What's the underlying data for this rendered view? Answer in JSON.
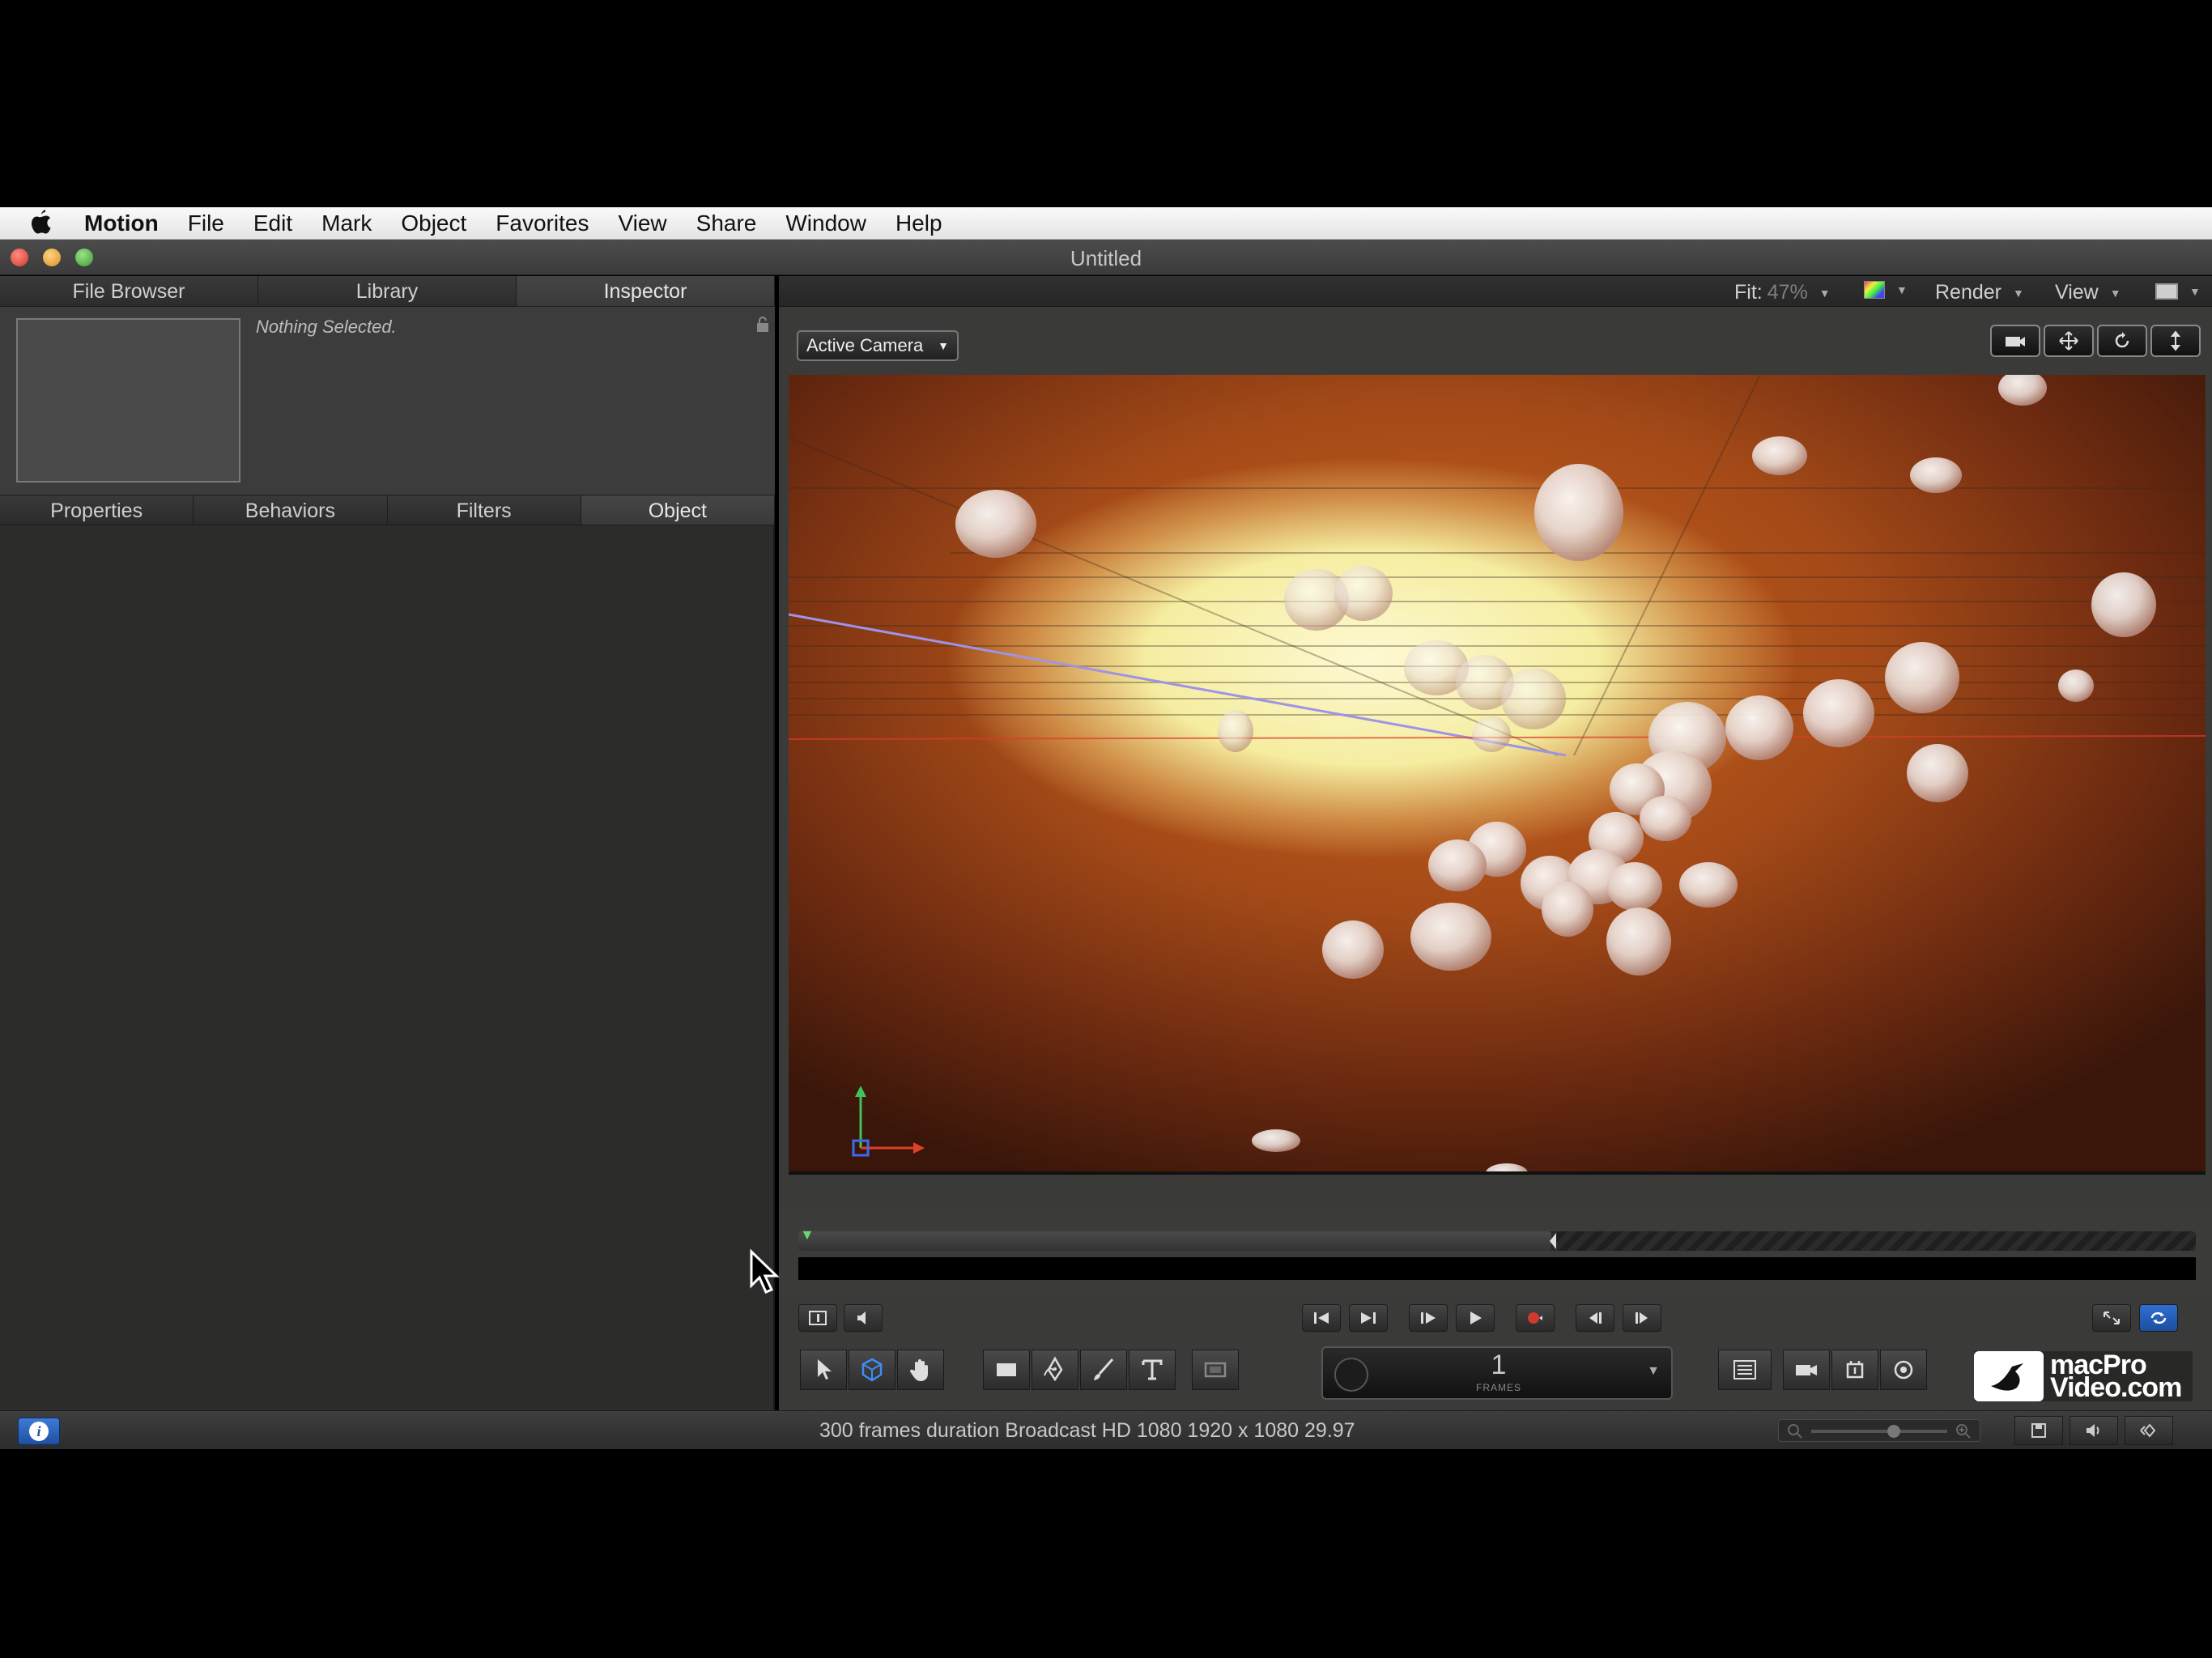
{
  "menubar": {
    "app_name": "Motion",
    "items": [
      "File",
      "Edit",
      "Mark",
      "Object",
      "Favorites",
      "View",
      "Share",
      "Window",
      "Help"
    ]
  },
  "window": {
    "title": "Untitled"
  },
  "left_pane": {
    "top_tabs": [
      "File Browser",
      "Library",
      "Inspector"
    ],
    "active_top_tab": "Inspector",
    "selection_text": "Nothing Selected.",
    "sub_tabs": [
      "Properties",
      "Behaviors",
      "Filters",
      "Object"
    ],
    "active_sub_tab": "Object"
  },
  "canvas_toolbar": {
    "fit_label": "Fit:",
    "fit_value": "47%",
    "render_label": "Render",
    "view_label": "View"
  },
  "canvas": {
    "camera_label": "Active Camera"
  },
  "toolbar": {
    "frame_value": "1",
    "frame_unit": "FRAMES"
  },
  "brand": {
    "line1": "macPro",
    "line2": "Video.com"
  },
  "status": {
    "text": "300 frames duration Broadcast HD 1080 1920 x 1080 29.97"
  },
  "colors": {
    "accent": "#3e8df5",
    "canvas_glow": "#fdf9d2",
    "canvas_bg": "#a44a18"
  },
  "icons": {
    "apple": "apple-icon",
    "lock": "lock-icon",
    "info": "info-icon"
  }
}
